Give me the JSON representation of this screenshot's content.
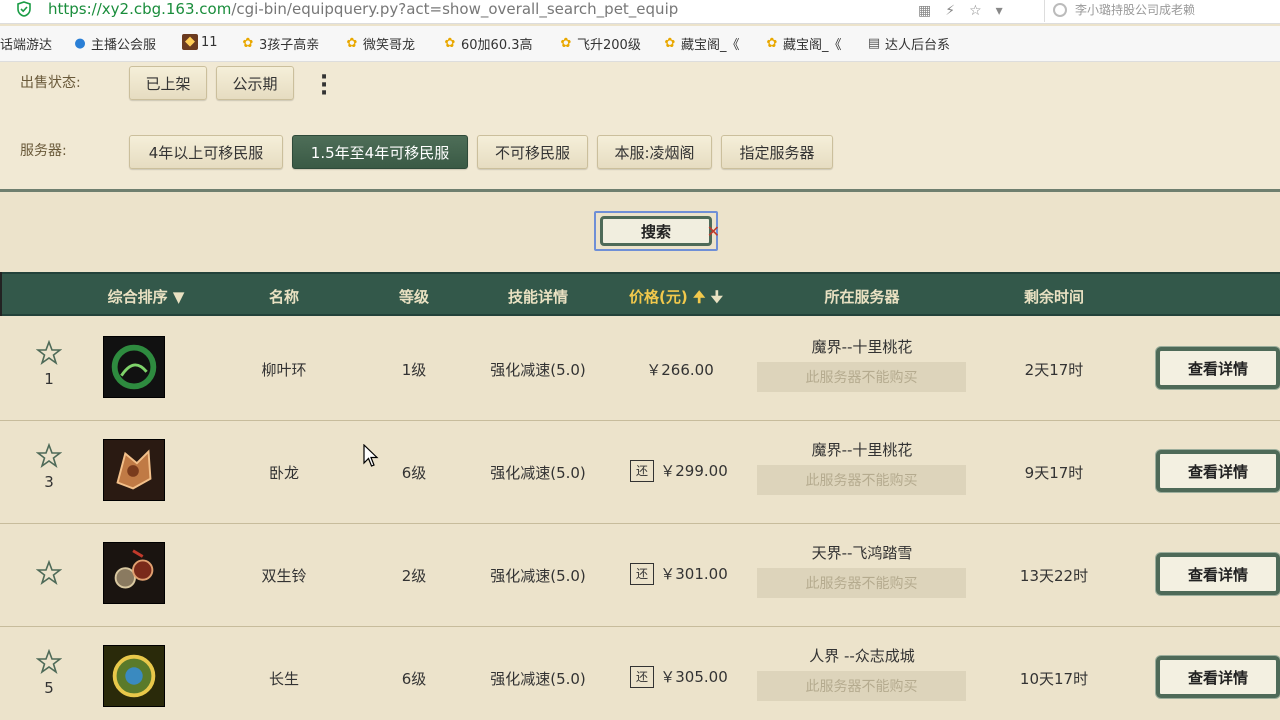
{
  "browser": {
    "url_domain": "https://xy2.cbg.163.com",
    "url_path": "/cgi-bin/equipquery.py?act=show_overall_search_pet_equip",
    "search_hint": "李小璐持股公司成老赖"
  },
  "bookmarks": [
    {
      "label": "话端游达",
      "icon": "none"
    },
    {
      "label": "主播公会服",
      "icon": "blue-circle-icon"
    },
    {
      "label": "11",
      "icon": "game-icon"
    },
    {
      "label": "3孩子高亲",
      "icon": "chick-icon"
    },
    {
      "label": "微笑哥龙",
      "icon": "chick-icon"
    },
    {
      "label": "60加60.3高",
      "icon": "chick-icon"
    },
    {
      "label": "飞升200级",
      "icon": "chick-icon"
    },
    {
      "label": "藏宝阁_《",
      "icon": "chick-icon"
    },
    {
      "label": "藏宝阁_《",
      "icon": "chick-icon"
    },
    {
      "label": "达人后台系",
      "icon": "doc-icon"
    }
  ],
  "filters": {
    "sale_status_label": "出售状态:",
    "sale_status_options": [
      "已上架",
      "公示期"
    ],
    "server_label": "服务器:",
    "server_options": [
      "4年以上可移民服",
      "1.5年至4年可移民服",
      "不可移民服",
      "本服:凌烟阁",
      "指定服务器"
    ],
    "server_active_index": 1
  },
  "search_button": "搜索",
  "table": {
    "headers": {
      "sort": "综合排序",
      "name": "名称",
      "level": "等级",
      "skill": "技能详情",
      "price": "价格(元)",
      "server": "所在服务器",
      "time": "剩余时间"
    },
    "no_buy_text": "此服务器不能购买",
    "detail_label": "查看详情",
    "rows": [
      {
        "rank": "1",
        "name": "柳叶环",
        "level": "1级",
        "skill": "强化减速(5.0)",
        "price": "￥266.00",
        "huan": "",
        "server": "魔界--十里桃花",
        "time": "2天17时"
      },
      {
        "rank": "3",
        "name": "卧龙",
        "level": "6级",
        "skill": "强化减速(5.0)",
        "price": "￥299.00",
        "huan": "还",
        "server": "魔界--十里桃花",
        "time": "9天17时"
      },
      {
        "rank": "",
        "name": "双生铃",
        "level": "2级",
        "skill": "强化减速(5.0)",
        "price": "￥301.00",
        "huan": "还",
        "server": "天界--飞鸿踏雪",
        "time": "13天22时"
      },
      {
        "rank": "5",
        "name": "长生",
        "level": "6级",
        "skill": "强化减速(5.0)",
        "price": "￥305.00",
        "huan": "还",
        "server": "人界 --众志成城",
        "time": "10天17时"
      }
    ]
  },
  "colors": {
    "header_bg": "#33584a",
    "active_filter": "#3a5a45",
    "price_header": "#f2c94c",
    "page_bg": "#ece3cb"
  }
}
